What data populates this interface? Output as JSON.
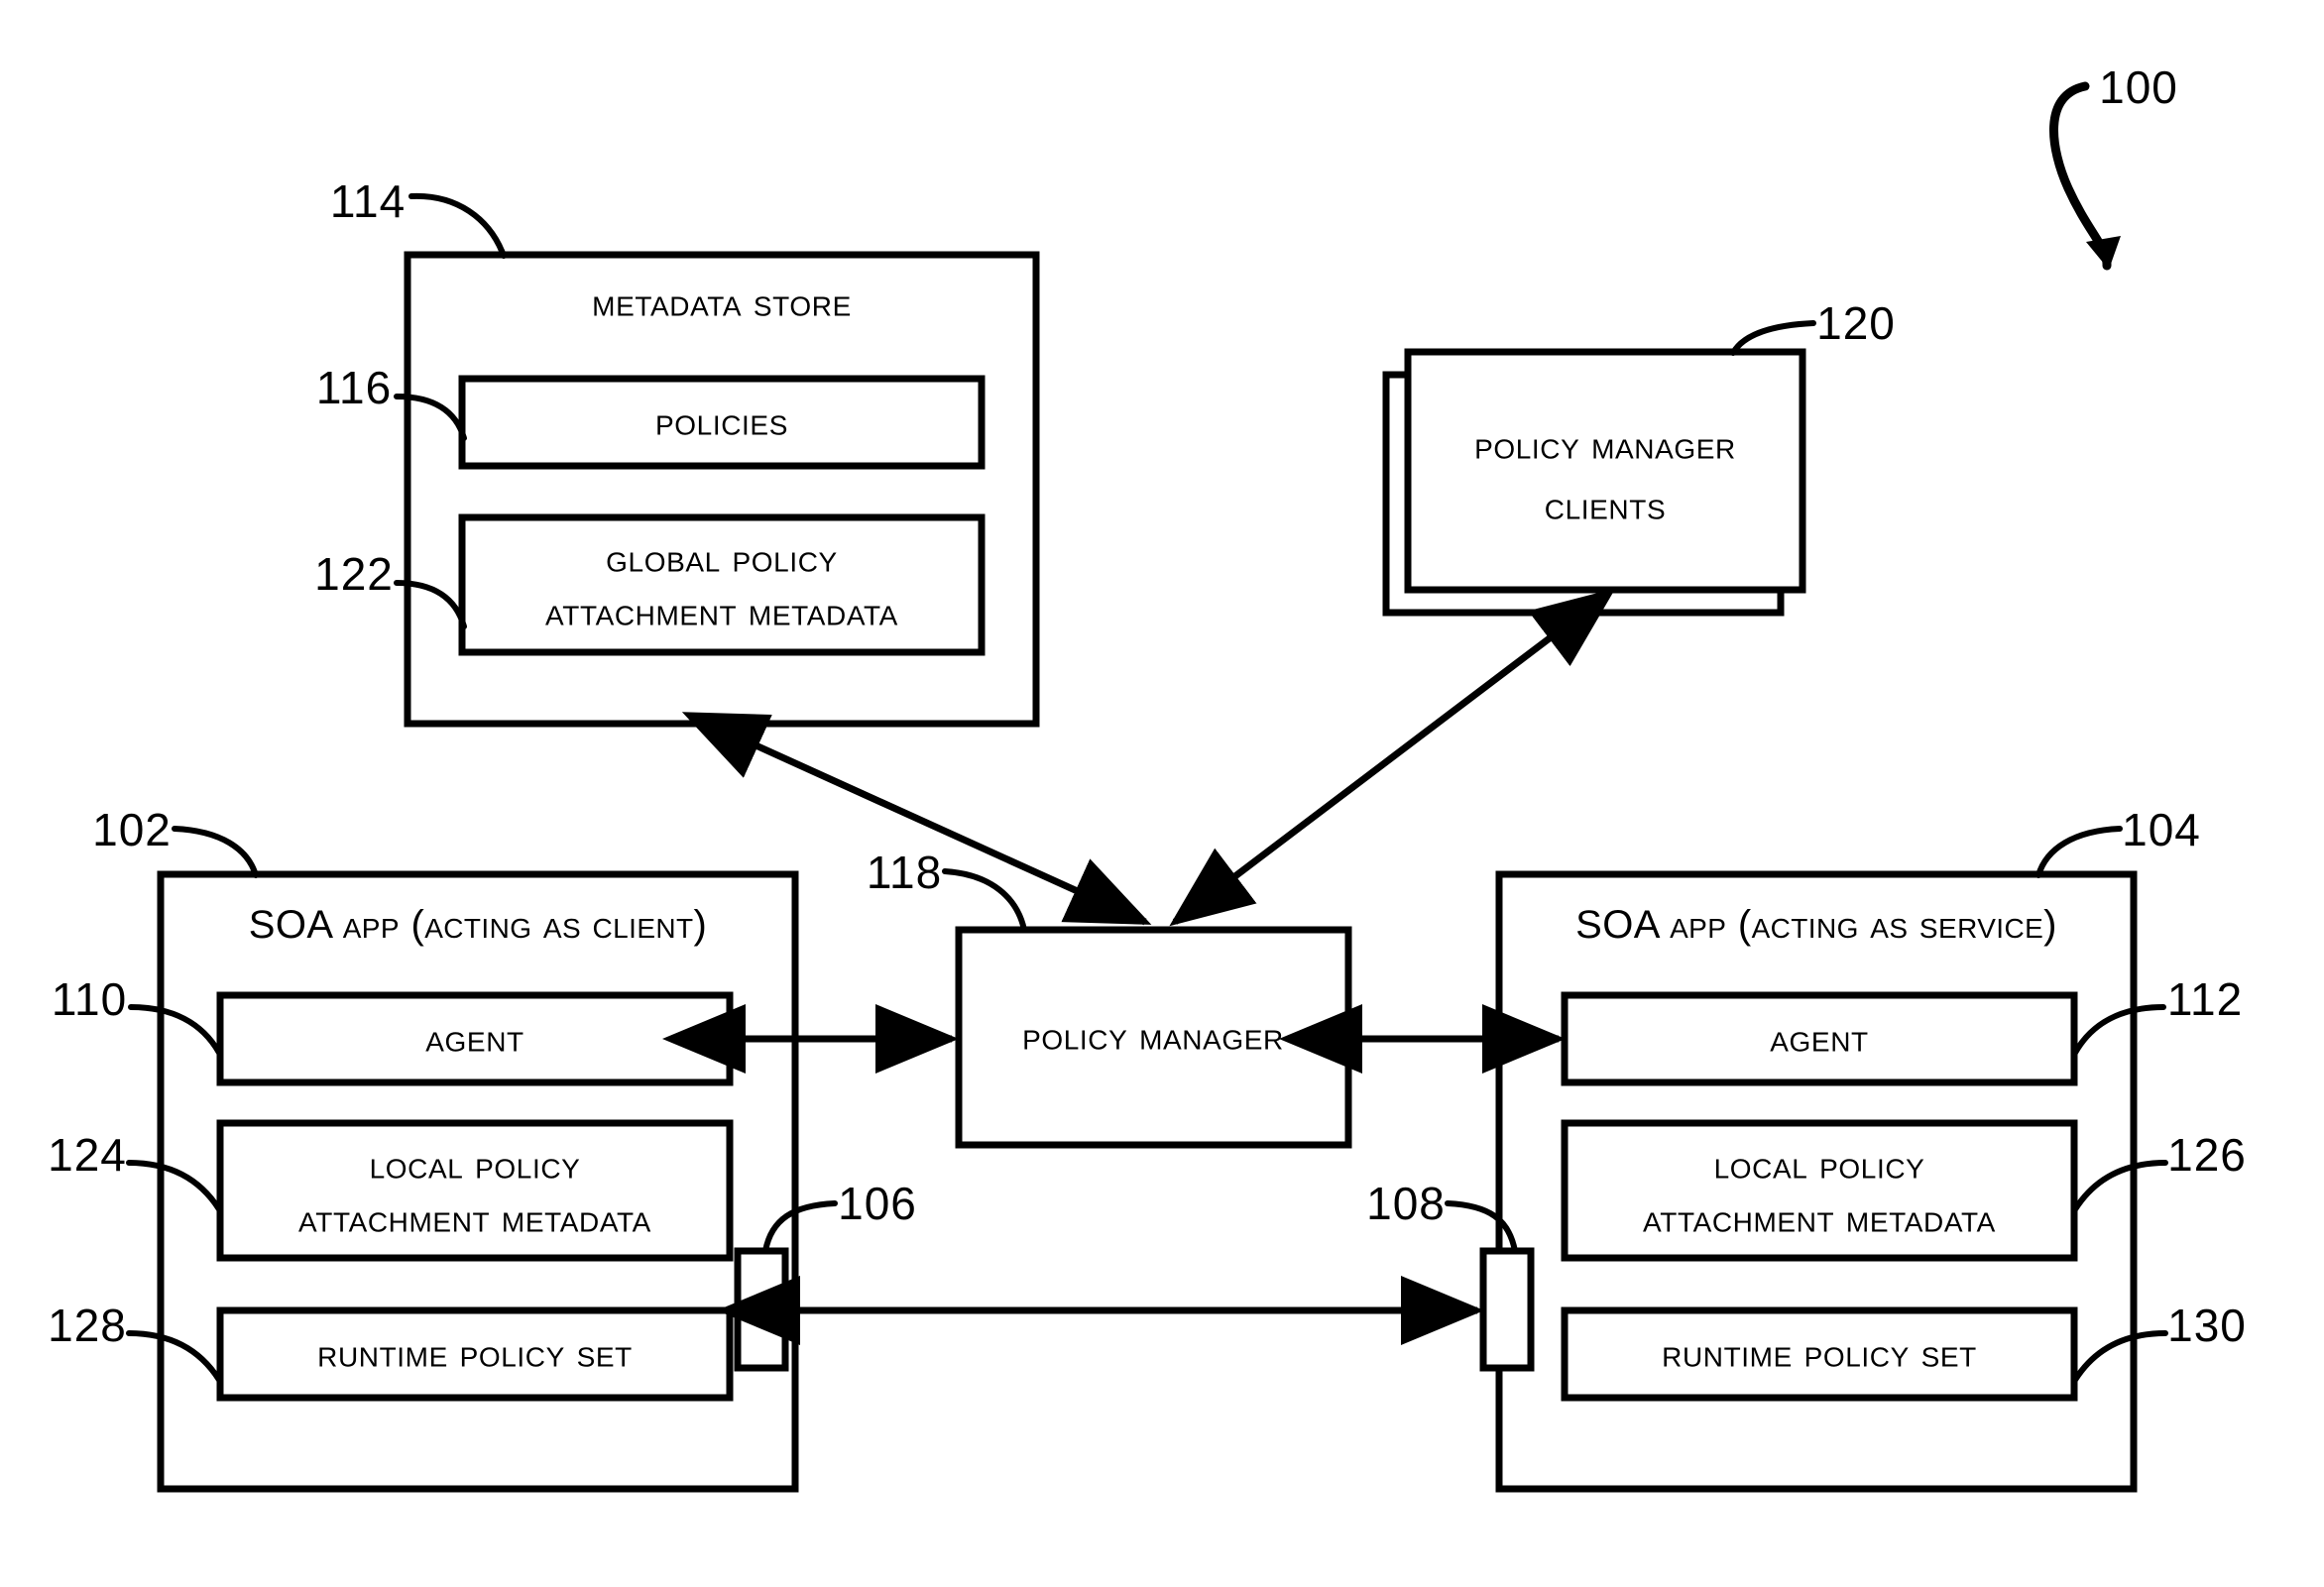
{
  "figure": {
    "figure_number": "100",
    "background_color": "#ffffff",
    "line_color": "#000000"
  },
  "blocks": {
    "metadata_store": {
      "ref": "114",
      "title": "Metadata Store",
      "children": [
        {
          "ref": "116",
          "label": "Policies"
        },
        {
          "ref": "122",
          "label_line1": "Global Policy",
          "label_line2": "Attachment Metadata"
        }
      ]
    },
    "policy_manager_clients": {
      "ref": "120",
      "label_line1": "Policy Manager",
      "label_line2": "Clients"
    },
    "policy_manager": {
      "ref": "118",
      "label": "Policy Manager"
    },
    "soa_app_client": {
      "ref": "102",
      "title_prefix": "SOA ",
      "title_rest": "App (Acting as client)",
      "children": [
        {
          "ref": "110",
          "label": "Agent"
        },
        {
          "ref": "124",
          "label_line1": "Local Policy",
          "label_line2": "Attachment Metadata"
        },
        {
          "ref": "128",
          "label": "Runtime Policy Set"
        }
      ],
      "connector": {
        "ref": "106"
      }
    },
    "soa_app_service": {
      "ref": "104",
      "title_prefix": "SOA ",
      "title_rest": "App (Acting as service)",
      "children": [
        {
          "ref": "112",
          "label": "Agent"
        },
        {
          "ref": "126",
          "label_line1": "Local Policy",
          "label_line2": "Attachment Metadata"
        },
        {
          "ref": "130",
          "label": "Runtime Policy Set"
        }
      ],
      "connector": {
        "ref": "108"
      }
    }
  },
  "connections": [
    {
      "name": "metadata-store-to-policy-manager",
      "style": "double-arrow-diagonal"
    },
    {
      "name": "policy-manager-to-policy-manager-clients",
      "style": "double-arrow-diagonal"
    },
    {
      "name": "client-agent-to-policy-manager",
      "style": "double-arrow-horizontal"
    },
    {
      "name": "policy-manager-to-service-agent",
      "style": "double-arrow-horizontal"
    },
    {
      "name": "client-connector-to-service-connector",
      "style": "double-arrow-horizontal"
    }
  ]
}
